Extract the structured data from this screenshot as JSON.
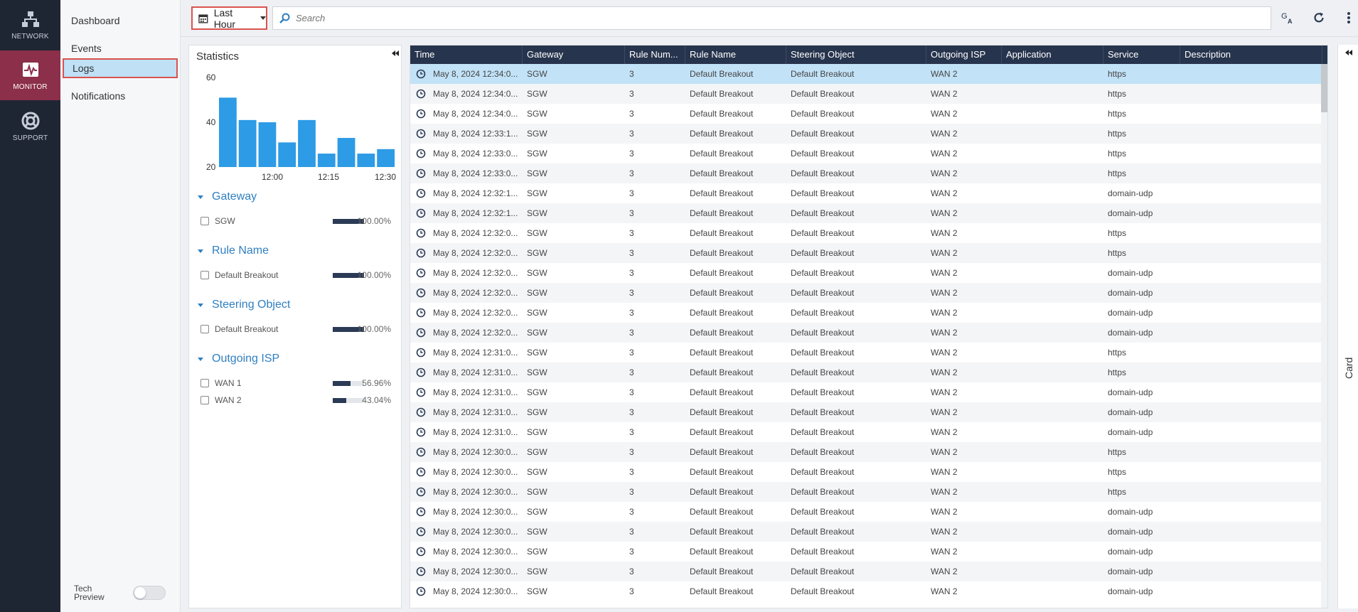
{
  "rail": {
    "items": [
      {
        "label": "NETWORK",
        "icon": "network-icon"
      },
      {
        "label": "MONITOR",
        "icon": "monitor-icon",
        "active": true
      },
      {
        "label": "SUPPORT",
        "icon": "support-icon"
      }
    ]
  },
  "subnav": {
    "items": [
      {
        "label": "Dashboard"
      },
      {
        "label": "Events"
      },
      {
        "label": "Logs",
        "active": true
      },
      {
        "label": "Notifications"
      }
    ],
    "tech_preview_line1": "Tech",
    "tech_preview_line2": "Preview"
  },
  "toolbar": {
    "range_label": "Last Hour",
    "search_placeholder": "Search"
  },
  "stats": {
    "title": "Statistics",
    "chart": {
      "y_ticks": [
        "60",
        "40",
        "20"
      ],
      "x_ticks": [
        "12:00",
        "12:15",
        "12:30"
      ],
      "ylim": [
        20,
        60
      ],
      "bar_color": "#2d9be5"
    },
    "facets": [
      {
        "title": "Gateway",
        "rows": [
          {
            "label": "SGW",
            "pct": "100.00%",
            "value": 100
          }
        ]
      },
      {
        "title": "Rule Name",
        "rows": [
          {
            "label": "Default Breakout",
            "pct": "100.00%",
            "value": 100
          }
        ]
      },
      {
        "title": "Steering Object",
        "rows": [
          {
            "label": "Default Breakout",
            "pct": "100.00%",
            "value": 100
          }
        ]
      },
      {
        "title": "Outgoing ISP",
        "rows": [
          {
            "label": "WAN 1",
            "pct": "56.96%",
            "value": 56.96
          },
          {
            "label": "WAN 2",
            "pct": "43.04%",
            "value": 43.04
          }
        ]
      }
    ]
  },
  "chart_data": {
    "type": "bar",
    "title": "",
    "xlabel": "",
    "ylabel": "",
    "x_tick_labels": [
      "12:00",
      "12:15",
      "12:30"
    ],
    "values": [
      51,
      41,
      40,
      31,
      41,
      26,
      33,
      26,
      28
    ],
    "ylim": [
      20,
      60
    ],
    "grid": false
  },
  "table": {
    "columns": [
      "Time",
      "Gateway",
      "Rule Num...",
      "Rule Name",
      "Steering Object",
      "Outgoing ISP",
      "Application",
      "Service",
      "Description"
    ],
    "rows": [
      [
        "May 8, 2024 12:34:0...",
        "SGW",
        "3",
        "Default Breakout",
        "Default Breakout",
        "WAN 2",
        "",
        "https",
        ""
      ],
      [
        "May 8, 2024 12:34:0...",
        "SGW",
        "3",
        "Default Breakout",
        "Default Breakout",
        "WAN 2",
        "",
        "https",
        ""
      ],
      [
        "May 8, 2024 12:34:0...",
        "SGW",
        "3",
        "Default Breakout",
        "Default Breakout",
        "WAN 2",
        "",
        "https",
        ""
      ],
      [
        "May 8, 2024 12:33:1...",
        "SGW",
        "3",
        "Default Breakout",
        "Default Breakout",
        "WAN 2",
        "",
        "https",
        ""
      ],
      [
        "May 8, 2024 12:33:0...",
        "SGW",
        "3",
        "Default Breakout",
        "Default Breakout",
        "WAN 2",
        "",
        "https",
        ""
      ],
      [
        "May 8, 2024 12:33:0...",
        "SGW",
        "3",
        "Default Breakout",
        "Default Breakout",
        "WAN 2",
        "",
        "https",
        ""
      ],
      [
        "May 8, 2024 12:32:1...",
        "SGW",
        "3",
        "Default Breakout",
        "Default Breakout",
        "WAN 2",
        "",
        "domain-udp",
        ""
      ],
      [
        "May 8, 2024 12:32:1...",
        "SGW",
        "3",
        "Default Breakout",
        "Default Breakout",
        "WAN 2",
        "",
        "domain-udp",
        ""
      ],
      [
        "May 8, 2024 12:32:0...",
        "SGW",
        "3",
        "Default Breakout",
        "Default Breakout",
        "WAN 2",
        "",
        "https",
        ""
      ],
      [
        "May 8, 2024 12:32:0...",
        "SGW",
        "3",
        "Default Breakout",
        "Default Breakout",
        "WAN 2",
        "",
        "https",
        ""
      ],
      [
        "May 8, 2024 12:32:0...",
        "SGW",
        "3",
        "Default Breakout",
        "Default Breakout",
        "WAN 2",
        "",
        "domain-udp",
        ""
      ],
      [
        "May 8, 2024 12:32:0...",
        "SGW",
        "3",
        "Default Breakout",
        "Default Breakout",
        "WAN 2",
        "",
        "domain-udp",
        ""
      ],
      [
        "May 8, 2024 12:32:0...",
        "SGW",
        "3",
        "Default Breakout",
        "Default Breakout",
        "WAN 2",
        "",
        "domain-udp",
        ""
      ],
      [
        "May 8, 2024 12:32:0...",
        "SGW",
        "3",
        "Default Breakout",
        "Default Breakout",
        "WAN 2",
        "",
        "domain-udp",
        ""
      ],
      [
        "May 8, 2024 12:31:0...",
        "SGW",
        "3",
        "Default Breakout",
        "Default Breakout",
        "WAN 2",
        "",
        "https",
        ""
      ],
      [
        "May 8, 2024 12:31:0...",
        "SGW",
        "3",
        "Default Breakout",
        "Default Breakout",
        "WAN 2",
        "",
        "https",
        ""
      ],
      [
        "May 8, 2024 12:31:0...",
        "SGW",
        "3",
        "Default Breakout",
        "Default Breakout",
        "WAN 2",
        "",
        "domain-udp",
        ""
      ],
      [
        "May 8, 2024 12:31:0...",
        "SGW",
        "3",
        "Default Breakout",
        "Default Breakout",
        "WAN 2",
        "",
        "domain-udp",
        ""
      ],
      [
        "May 8, 2024 12:31:0...",
        "SGW",
        "3",
        "Default Breakout",
        "Default Breakout",
        "WAN 2",
        "",
        "domain-udp",
        ""
      ],
      [
        "May 8, 2024 12:30:0...",
        "SGW",
        "3",
        "Default Breakout",
        "Default Breakout",
        "WAN 2",
        "",
        "https",
        ""
      ],
      [
        "May 8, 2024 12:30:0...",
        "SGW",
        "3",
        "Default Breakout",
        "Default Breakout",
        "WAN 2",
        "",
        "https",
        ""
      ],
      [
        "May 8, 2024 12:30:0...",
        "SGW",
        "3",
        "Default Breakout",
        "Default Breakout",
        "WAN 2",
        "",
        "https",
        ""
      ],
      [
        "May 8, 2024 12:30:0...",
        "SGW",
        "3",
        "Default Breakout",
        "Default Breakout",
        "WAN 2",
        "",
        "domain-udp",
        ""
      ],
      [
        "May 8, 2024 12:30:0...",
        "SGW",
        "3",
        "Default Breakout",
        "Default Breakout",
        "WAN 2",
        "",
        "domain-udp",
        ""
      ],
      [
        "May 8, 2024 12:30:0...",
        "SGW",
        "3",
        "Default Breakout",
        "Default Breakout",
        "WAN 2",
        "",
        "domain-udp",
        ""
      ],
      [
        "May 8, 2024 12:30:0...",
        "SGW",
        "3",
        "Default Breakout",
        "Default Breakout",
        "WAN 2",
        "",
        "domain-udp",
        ""
      ],
      [
        "May 8, 2024 12:30:0...",
        "SGW",
        "3",
        "Default Breakout",
        "Default Breakout",
        "WAN 2",
        "",
        "domain-udp",
        ""
      ]
    ],
    "selected_row": 0
  },
  "card_panel": {
    "label": "Card"
  },
  "colors": {
    "rail_bg": "#1f2633",
    "rail_active": "#8b2f4a",
    "header_bg": "#27344d",
    "selected_row": "#c2e2f7",
    "accent_blue": "#2f7fc1",
    "highlight_border": "#d9534f"
  }
}
